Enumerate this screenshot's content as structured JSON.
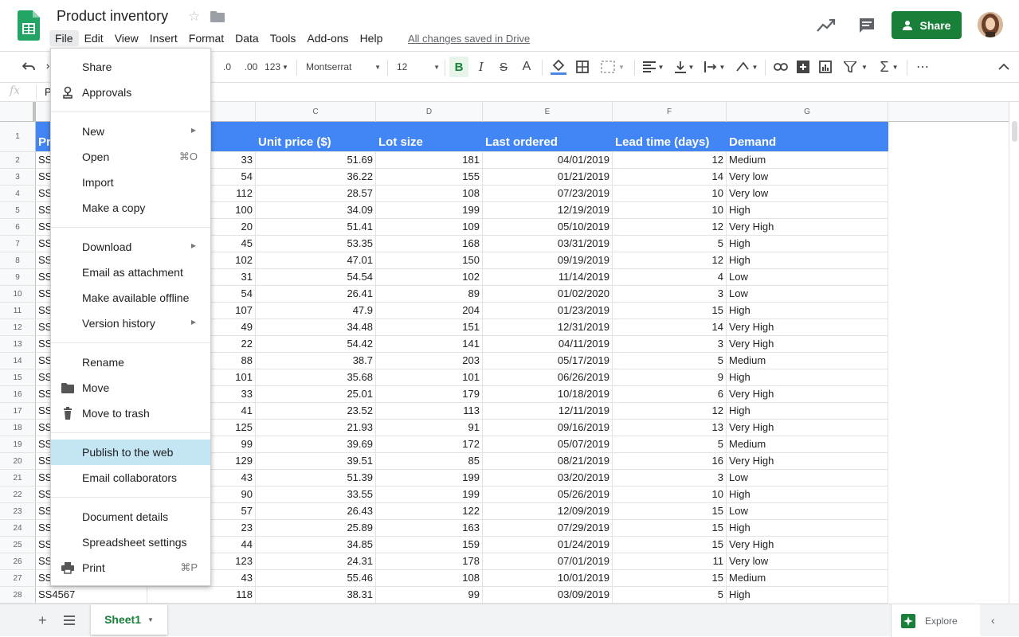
{
  "app": {
    "doc_title": "Product inventory",
    "saved_status": "All changes saved in Drive",
    "share_label": "Share",
    "accent": "#188038"
  },
  "menubar": [
    "File",
    "Edit",
    "View",
    "Insert",
    "Format",
    "Data",
    "Tools",
    "Add-ons",
    "Help"
  ],
  "toolbar": {
    "dec_decrease": ".0",
    "dec_increase": ".00",
    "more_formats": "123",
    "font_name": "Montserrat",
    "font_size": "12",
    "bold": "B",
    "italic": "I",
    "strike": "S",
    "text_color": "A"
  },
  "formula_bar": {
    "fx": "fx",
    "value": "P"
  },
  "columns": [
    "C",
    "D",
    "E",
    "F",
    "G"
  ],
  "header_row": {
    "a": "Pr",
    "c": "Unit price ($)",
    "d": "Lot size",
    "e": "Last ordered",
    "f": "Lead time (days)",
    "g": "Demand"
  },
  "rows": [
    {
      "n": "2",
      "a": "SS",
      "b": "33",
      "c": "51.69",
      "d": "181",
      "e": "04/01/2019",
      "f": "12",
      "g": "Medium"
    },
    {
      "n": "3",
      "a": "SS",
      "b": "54",
      "c": "36.22",
      "d": "155",
      "e": "01/21/2019",
      "f": "14",
      "g": "Very low"
    },
    {
      "n": "4",
      "a": "SS",
      "b": "112",
      "c": "28.57",
      "d": "108",
      "e": "07/23/2019",
      "f": "10",
      "g": "Very low"
    },
    {
      "n": "5",
      "a": "SS",
      "b": "100",
      "c": "34.09",
      "d": "199",
      "e": "12/19/2019",
      "f": "10",
      "g": "High"
    },
    {
      "n": "6",
      "a": "SS",
      "b": "20",
      "c": "51.41",
      "d": "109",
      "e": "05/10/2019",
      "f": "12",
      "g": "Very High"
    },
    {
      "n": "7",
      "a": "SS",
      "b": "45",
      "c": "53.35",
      "d": "168",
      "e": "03/31/2019",
      "f": "5",
      "g": "High"
    },
    {
      "n": "8",
      "a": "SS",
      "b": "102",
      "c": "47.01",
      "d": "150",
      "e": "09/19/2019",
      "f": "12",
      "g": "High"
    },
    {
      "n": "9",
      "a": "SS",
      "b": "31",
      "c": "54.54",
      "d": "102",
      "e": "11/14/2019",
      "f": "4",
      "g": "Low"
    },
    {
      "n": "10",
      "a": "SS",
      "b": "54",
      "c": "26.41",
      "d": "89",
      "e": "01/02/2020",
      "f": "3",
      "g": "Low"
    },
    {
      "n": "11",
      "a": "SS",
      "b": "107",
      "c": "47.9",
      "d": "204",
      "e": "01/23/2019",
      "f": "15",
      "g": "High"
    },
    {
      "n": "12",
      "a": "SS",
      "b": "49",
      "c": "34.48",
      "d": "151",
      "e": "12/31/2019",
      "f": "14",
      "g": "Very High"
    },
    {
      "n": "13",
      "a": "SS",
      "b": "22",
      "c": "54.42",
      "d": "141",
      "e": "04/11/2019",
      "f": "3",
      "g": "Very High"
    },
    {
      "n": "14",
      "a": "SS",
      "b": "88",
      "c": "38.7",
      "d": "203",
      "e": "05/17/2019",
      "f": "5",
      "g": "Medium"
    },
    {
      "n": "15",
      "a": "SS",
      "b": "101",
      "c": "35.68",
      "d": "101",
      "e": "06/26/2019",
      "f": "9",
      "g": "High"
    },
    {
      "n": "16",
      "a": "SS",
      "b": "33",
      "c": "25.01",
      "d": "179",
      "e": "10/18/2019",
      "f": "6",
      "g": "Very High"
    },
    {
      "n": "17",
      "a": "SS",
      "b": "41",
      "c": "23.52",
      "d": "113",
      "e": "12/11/2019",
      "f": "12",
      "g": "High"
    },
    {
      "n": "18",
      "a": "SS",
      "b": "125",
      "c": "21.93",
      "d": "91",
      "e": "09/16/2019",
      "f": "13",
      "g": "Very High"
    },
    {
      "n": "19",
      "a": "SS",
      "b": "99",
      "c": "39.69",
      "d": "172",
      "e": "05/07/2019",
      "f": "5",
      "g": "Medium"
    },
    {
      "n": "20",
      "a": "SS",
      "b": "129",
      "c": "39.51",
      "d": "85",
      "e": "08/21/2019",
      "f": "16",
      "g": "Very High"
    },
    {
      "n": "21",
      "a": "SS",
      "b": "43",
      "c": "51.39",
      "d": "199",
      "e": "03/20/2019",
      "f": "3",
      "g": "Low"
    },
    {
      "n": "22",
      "a": "SS",
      "b": "90",
      "c": "33.55",
      "d": "199",
      "e": "05/26/2019",
      "f": "10",
      "g": "High"
    },
    {
      "n": "23",
      "a": "SS",
      "b": "57",
      "c": "26.43",
      "d": "122",
      "e": "12/09/2019",
      "f": "15",
      "g": "Low"
    },
    {
      "n": "24",
      "a": "SS",
      "b": "23",
      "c": "25.89",
      "d": "163",
      "e": "07/29/2019",
      "f": "15",
      "g": "High"
    },
    {
      "n": "25",
      "a": "SS",
      "b": "44",
      "c": "34.85",
      "d": "159",
      "e": "01/24/2019",
      "f": "15",
      "g": "Very High"
    },
    {
      "n": "26",
      "a": "SS",
      "b": "123",
      "c": "24.31",
      "d": "178",
      "e": "07/01/2019",
      "f": "11",
      "g": "Very low"
    },
    {
      "n": "27",
      "a": "SS",
      "b": "43",
      "c": "55.46",
      "d": "108",
      "e": "10/01/2019",
      "f": "15",
      "g": "Medium"
    },
    {
      "n": "28",
      "a": "SS4567",
      "b": "118",
      "c": "38.31",
      "d": "99",
      "e": "03/09/2019",
      "f": "5",
      "g": "High"
    }
  ],
  "file_menu": {
    "share": "Share",
    "approvals": "Approvals",
    "new": "New",
    "open": "Open",
    "open_shortcut": "⌘O",
    "import": "Import",
    "make_copy": "Make a copy",
    "download": "Download",
    "email_attachment": "Email as attachment",
    "offline": "Make available offline",
    "version_history": "Version history",
    "rename": "Rename",
    "move": "Move",
    "trash": "Move to trash",
    "publish": "Publish to the web",
    "email_collab": "Email collaborators",
    "doc_details": "Document details",
    "ss_settings": "Spreadsheet settings",
    "print": "Print",
    "print_shortcut": "⌘P"
  },
  "bottom": {
    "sheet_name": "Sheet1",
    "explore": "Explore"
  },
  "row1_label": "1"
}
